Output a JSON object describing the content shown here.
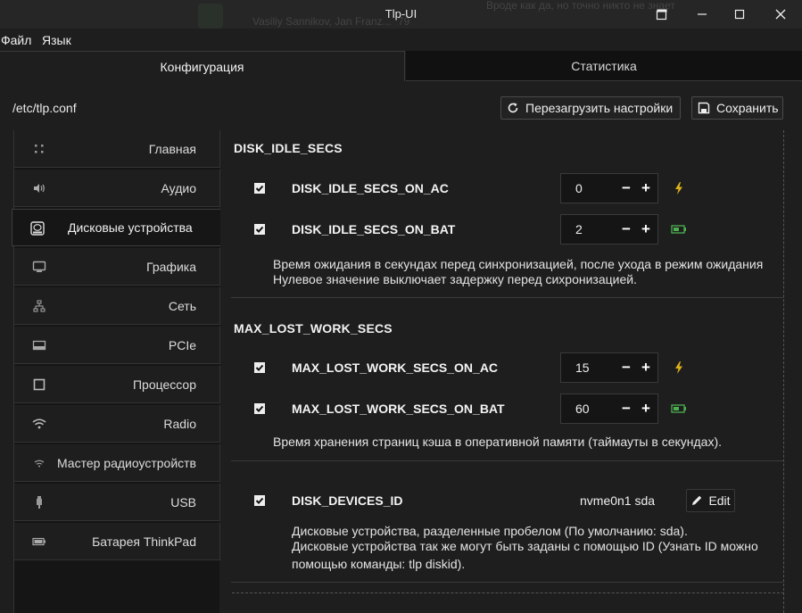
{
  "window": {
    "title": "Tlp-UI",
    "ghost_text_1": "Vasiliy Sannikov, Jan Franz...",
    "ghost_count": "79",
    "ghost_text_2": "Вроде как да, но точно никто не знает"
  },
  "menu": [
    {
      "label": "Файл"
    },
    {
      "label": "Язык"
    }
  ],
  "tabs": {
    "config": "Конфигурация",
    "stats": "Статистика"
  },
  "toolbar": {
    "file_path": "/etc/tlp.conf",
    "reload_label": "Перезагрузить настройки",
    "save_label": "Сохранить"
  },
  "sidebar": {
    "items": [
      {
        "label": "Главная",
        "icon": "grid-dots-icon"
      },
      {
        "label": "Аудио",
        "icon": "speaker-icon"
      },
      {
        "label": "Дисковые устройства",
        "icon": "disk-icon",
        "active": true
      },
      {
        "label": "Графика",
        "icon": "monitor-icon"
      },
      {
        "label": "Сеть",
        "icon": "network-icon"
      },
      {
        "label": "PCIe",
        "icon": "pcie-icon"
      },
      {
        "label": "Процессор",
        "icon": "cpu-icon"
      },
      {
        "label": "Radio",
        "icon": "wifi-icon"
      },
      {
        "label": "Мастер радиоустройств",
        "icon": "wifi-small-icon"
      },
      {
        "label": "USB",
        "icon": "usb-icon"
      },
      {
        "label": "Батарея ThinkPad",
        "icon": "battery-icon"
      }
    ]
  },
  "sections": {
    "disk_idle": {
      "title": "DISK_IDLE_SECS",
      "rows": [
        {
          "label": "DISK_IDLE_SECS_ON_AC",
          "value": "0",
          "checked": true,
          "power": "ac"
        },
        {
          "label": "DISK_IDLE_SECS_ON_BAT",
          "value": "2",
          "checked": true,
          "power": "battery"
        }
      ],
      "desc_line1": "Время ожидания в секундах перед синхронизацией, после ухода в режим ожидания",
      "desc_line2": "Нулевое значение выключает задержку перед сихронизацией."
    },
    "max_lost": {
      "title": "MAX_LOST_WORK_SECS",
      "rows": [
        {
          "label": "MAX_LOST_WORK_SECS_ON_AC",
          "value": "15",
          "checked": true,
          "power": "ac"
        },
        {
          "label": "MAX_LOST_WORK_SECS_ON_BAT",
          "value": "60",
          "checked": true,
          "power": "battery"
        }
      ],
      "desc_line1": "Время хранения страниц кэша в оперативной памяти (таймауты в секундах)."
    },
    "disk_devices": {
      "label": "DISK_DEVICES_ID",
      "value": "nvme0n1 sda",
      "checked": true,
      "edit_label": "Edit",
      "desc_line1": "Дисковые устройства, разделенные пробелом (По умолчанию: sda).",
      "desc_line2": "Дисковые устройства так же могут быть заданы с помощью ID (Узнать ID можно",
      "desc_line3": "помощью команды: tlp diskid)."
    }
  },
  "colors": {
    "ac_icon": "#e0b21a",
    "battery_icon": "#4caf50",
    "background": "#1e1e1e"
  }
}
